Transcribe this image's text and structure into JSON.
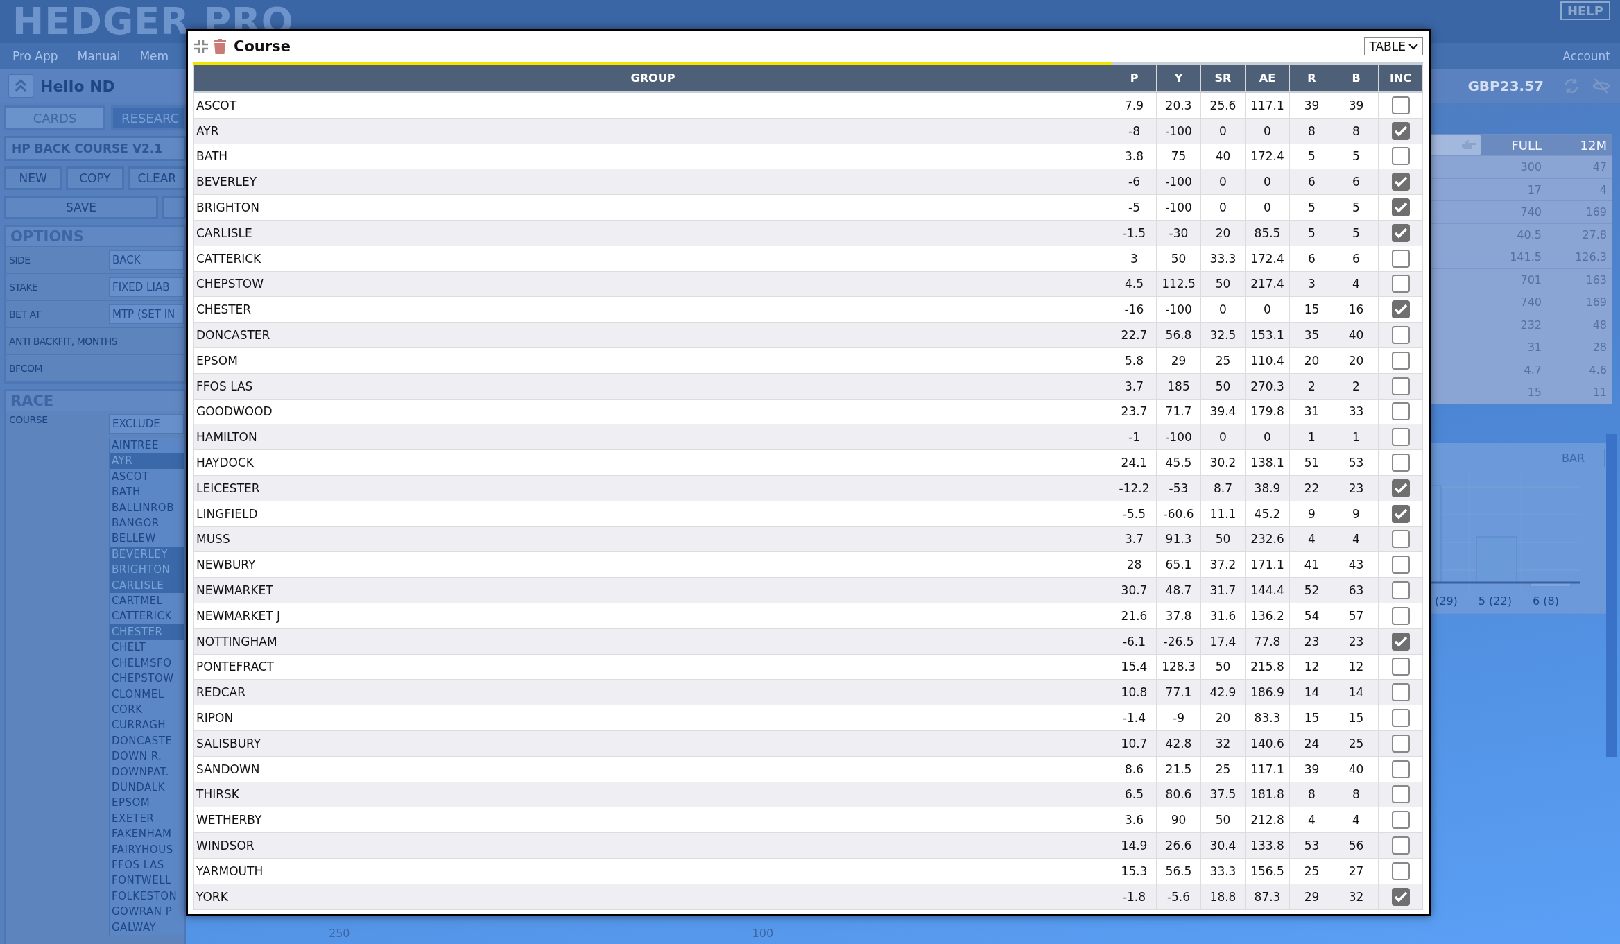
{
  "app": {
    "logo": "HEDGER PRO",
    "help": "HELP",
    "nav": [
      "Pro App",
      "Manual",
      "Mem"
    ],
    "account": "Account",
    "greeting": "Hello ND",
    "balance": "GBP23.57"
  },
  "sidebar": {
    "tabs": [
      {
        "label": "CARDS",
        "selected": false
      },
      {
        "label": "RESEARC",
        "selected": true
      }
    ],
    "system": "HP BACK COURSE V2.1",
    "actions": [
      "NEW",
      "COPY",
      "CLEAR"
    ],
    "save": "SAVE",
    "options": {
      "title": "OPTIONS",
      "fields": [
        {
          "label": "SIDE",
          "value": "BACK"
        },
        {
          "label": "STAKE",
          "value": "FIXED LIAB"
        },
        {
          "label": "BET AT",
          "value": "MTP (SET IN"
        },
        {
          "label": "ANTI BACKFIT, MONTHS"
        },
        {
          "label": "BFCOM"
        }
      ]
    },
    "race": {
      "title": "RACE",
      "course_label": "COURSE",
      "course_mode": "EXCLUDE",
      "courses": [
        {
          "name": "AINTREE",
          "selected": false
        },
        {
          "name": "AYR",
          "selected": true
        },
        {
          "name": "ASCOT",
          "selected": false
        },
        {
          "name": "BATH",
          "selected": false
        },
        {
          "name": "BALLINROB",
          "selected": false
        },
        {
          "name": "BANGOR",
          "selected": false
        },
        {
          "name": "BELLEW",
          "selected": false
        },
        {
          "name": "BEVERLEY",
          "selected": true
        },
        {
          "name": "BRIGHTON",
          "selected": true
        },
        {
          "name": "CARLISLE",
          "selected": true
        },
        {
          "name": "CARTMEL",
          "selected": false
        },
        {
          "name": "CATTERICK",
          "selected": false
        },
        {
          "name": "CHESTER",
          "selected": true
        },
        {
          "name": "CHELT",
          "selected": false
        },
        {
          "name": "CHELMSFO",
          "selected": false
        },
        {
          "name": "CHEPSTOW",
          "selected": false
        },
        {
          "name": "CLONMEL",
          "selected": false
        },
        {
          "name": "CORK",
          "selected": false
        },
        {
          "name": "CURRAGH",
          "selected": false
        },
        {
          "name": "DONCASTE",
          "selected": false
        },
        {
          "name": "DOWN R.",
          "selected": false
        },
        {
          "name": "DOWNPAT.",
          "selected": false
        },
        {
          "name": "DUNDALK",
          "selected": false
        },
        {
          "name": "EPSOM",
          "selected": false
        },
        {
          "name": "EXETER",
          "selected": false
        },
        {
          "name": "FAKENHAM",
          "selected": false
        },
        {
          "name": "FAIRYHOUS",
          "selected": false
        },
        {
          "name": "FFOS LAS",
          "selected": false
        },
        {
          "name": "FONTWELL",
          "selected": false
        },
        {
          "name": "FOLKESTON",
          "selected": false
        },
        {
          "name": "GOWRAN P",
          "selected": false
        },
        {
          "name": "GALWAY",
          "selected": false
        }
      ]
    }
  },
  "summary": {
    "columns": [
      "FULL",
      "12M"
    ],
    "rows": [
      [
        "300",
        "47"
      ],
      [
        "17",
        "4"
      ],
      [
        "740",
        "169"
      ],
      [
        "40.5",
        "27.8"
      ],
      [
        "141.5",
        "126.3"
      ],
      [
        "701",
        "163"
      ],
      [
        "740",
        "169"
      ],
      [
        "232",
        "48"
      ],
      [
        "31",
        "28"
      ],
      [
        "4.7",
        "4.6"
      ],
      [
        "15",
        "11"
      ]
    ]
  },
  "chart_panel": {
    "type_select": "BAR",
    "labels": [
      "(29)",
      "5 (22)",
      "6 (8)"
    ]
  },
  "footer_labels": [
    "250",
    "100"
  ],
  "modal": {
    "title": "Course",
    "view": "TABLE",
    "columns": [
      "GROUP",
      "P",
      "Y",
      "SR",
      "AE",
      "R",
      "B",
      "INC"
    ],
    "rows": [
      {
        "group": "ASCOT",
        "values": [
          "7.9",
          "20.3",
          "25.6",
          "117.1",
          "39",
          "39"
        ],
        "included": false
      },
      {
        "group": "AYR",
        "values": [
          "-8",
          "-100",
          "0",
          "0",
          "8",
          "8"
        ],
        "included": true
      },
      {
        "group": "BATH",
        "values": [
          "3.8",
          "75",
          "40",
          "172.4",
          "5",
          "5"
        ],
        "included": false
      },
      {
        "group": "BEVERLEY",
        "values": [
          "-6",
          "-100",
          "0",
          "0",
          "6",
          "6"
        ],
        "included": true
      },
      {
        "group": "BRIGHTON",
        "values": [
          "-5",
          "-100",
          "0",
          "0",
          "5",
          "5"
        ],
        "included": true
      },
      {
        "group": "CARLISLE",
        "values": [
          "-1.5",
          "-30",
          "20",
          "85.5",
          "5",
          "5"
        ],
        "included": true
      },
      {
        "group": "CATTERICK",
        "values": [
          "3",
          "50",
          "33.3",
          "172.4",
          "6",
          "6"
        ],
        "included": false
      },
      {
        "group": "CHEPSTOW",
        "values": [
          "4.5",
          "112.5",
          "50",
          "217.4",
          "3",
          "4"
        ],
        "included": false
      },
      {
        "group": "CHESTER",
        "values": [
          "-16",
          "-100",
          "0",
          "0",
          "15",
          "16"
        ],
        "included": true
      },
      {
        "group": "DONCASTER",
        "values": [
          "22.7",
          "56.8",
          "32.5",
          "153.1",
          "35",
          "40"
        ],
        "included": false
      },
      {
        "group": "EPSOM",
        "values": [
          "5.8",
          "29",
          "25",
          "110.4",
          "20",
          "20"
        ],
        "included": false
      },
      {
        "group": "FFOS LAS",
        "values": [
          "3.7",
          "185",
          "50",
          "270.3",
          "2",
          "2"
        ],
        "included": false
      },
      {
        "group": "GOODWOOD",
        "values": [
          "23.7",
          "71.7",
          "39.4",
          "179.8",
          "31",
          "33"
        ],
        "included": false
      },
      {
        "group": "HAMILTON",
        "values": [
          "-1",
          "-100",
          "0",
          "0",
          "1",
          "1"
        ],
        "included": false
      },
      {
        "group": "HAYDOCK",
        "values": [
          "24.1",
          "45.5",
          "30.2",
          "138.1",
          "51",
          "53"
        ],
        "included": false
      },
      {
        "group": "LEICESTER",
        "values": [
          "-12.2",
          "-53",
          "8.7",
          "38.9",
          "22",
          "23"
        ],
        "included": true
      },
      {
        "group": "LINGFIELD",
        "values": [
          "-5.5",
          "-60.6",
          "11.1",
          "45.2",
          "9",
          "9"
        ],
        "included": true
      },
      {
        "group": "MUSS",
        "values": [
          "3.7",
          "91.3",
          "50",
          "232.6",
          "4",
          "4"
        ],
        "included": false
      },
      {
        "group": "NEWBURY",
        "values": [
          "28",
          "65.1",
          "37.2",
          "171.1",
          "41",
          "43"
        ],
        "included": false
      },
      {
        "group": "NEWMARKET",
        "values": [
          "30.7",
          "48.7",
          "31.7",
          "144.4",
          "52",
          "63"
        ],
        "included": false
      },
      {
        "group": "NEWMARKET J",
        "values": [
          "21.6",
          "37.8",
          "31.6",
          "136.2",
          "54",
          "57"
        ],
        "included": false
      },
      {
        "group": "NOTTINGHAM",
        "values": [
          "-6.1",
          "-26.5",
          "17.4",
          "77.8",
          "23",
          "23"
        ],
        "included": true
      },
      {
        "group": "PONTEFRACT",
        "values": [
          "15.4",
          "128.3",
          "50",
          "215.8",
          "12",
          "12"
        ],
        "included": false
      },
      {
        "group": "REDCAR",
        "values": [
          "10.8",
          "77.1",
          "42.9",
          "186.9",
          "14",
          "14"
        ],
        "included": false
      },
      {
        "group": "RIPON",
        "values": [
          "-1.4",
          "-9",
          "20",
          "83.3",
          "15",
          "15"
        ],
        "included": false
      },
      {
        "group": "SALISBURY",
        "values": [
          "10.7",
          "42.8",
          "32",
          "140.6",
          "24",
          "25"
        ],
        "included": false
      },
      {
        "group": "SANDOWN",
        "values": [
          "8.6",
          "21.5",
          "25",
          "117.1",
          "39",
          "40"
        ],
        "included": false
      },
      {
        "group": "THIRSK",
        "values": [
          "6.5",
          "80.6",
          "37.5",
          "181.8",
          "8",
          "8"
        ],
        "included": false
      },
      {
        "group": "WETHERBY",
        "values": [
          "3.6",
          "90",
          "50",
          "212.8",
          "4",
          "4"
        ],
        "included": false
      },
      {
        "group": "WINDSOR",
        "values": [
          "14.9",
          "26.6",
          "30.4",
          "133.8",
          "53",
          "56"
        ],
        "included": false
      },
      {
        "group": "YARMOUTH",
        "values": [
          "15.3",
          "56.5",
          "33.3",
          "156.5",
          "25",
          "27"
        ],
        "included": false
      },
      {
        "group": "YORK",
        "values": [
          "-1.8",
          "-5.6",
          "18.8",
          "87.3",
          "29",
          "32"
        ],
        "included": true
      }
    ]
  }
}
